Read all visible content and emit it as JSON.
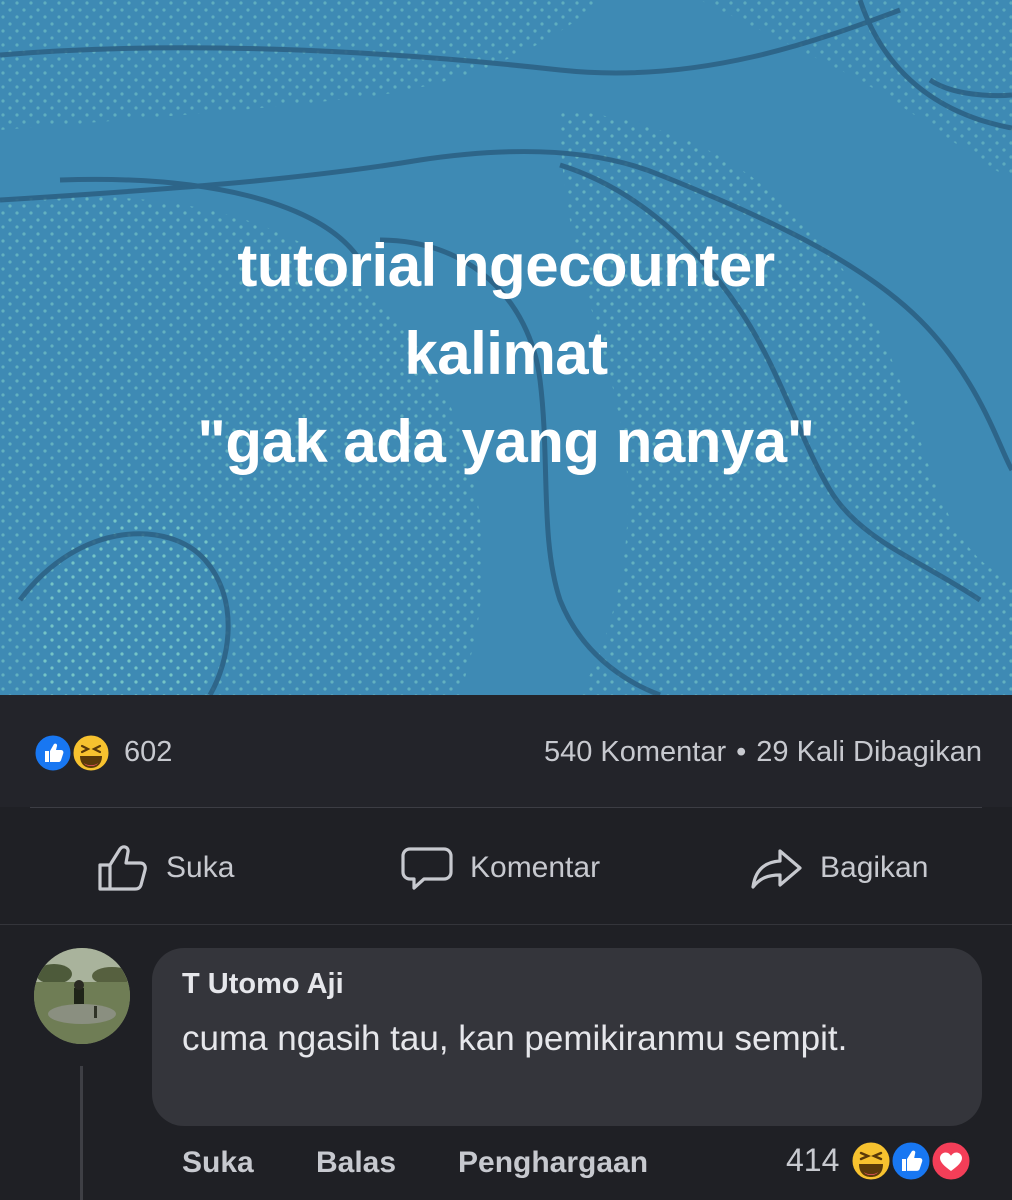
{
  "post": {
    "text_lines": [
      "tutorial ngecounter",
      "kalimat",
      "\"gak ada yang nanya\""
    ],
    "background_color": "#3e8ab4"
  },
  "stats": {
    "reactions": [
      "like-reaction-icon",
      "haha-reaction-icon"
    ],
    "reaction_count": "602",
    "comments": "540 Komentar",
    "separator": "•",
    "shares": "29 Kali Dibagikan"
  },
  "actions": {
    "like": "Suka",
    "comment": "Komentar",
    "share": "Bagikan"
  },
  "comment": {
    "author": "T Utomo Aji",
    "text": "cuma ngasih tau, kan pemikiranmu sempit.",
    "like": "Suka",
    "reply": "Balas",
    "award": "Penghargaan",
    "reaction_count": "414",
    "reactions": [
      "haha-reaction-icon",
      "like-reaction-icon",
      "love-reaction-icon"
    ]
  },
  "colors": {
    "app_background": "#1f2025",
    "bubble": "#34353b",
    "like_blue": "#1877f2",
    "haha_yellow": "#f7c22f",
    "love_red": "#f33e58"
  }
}
